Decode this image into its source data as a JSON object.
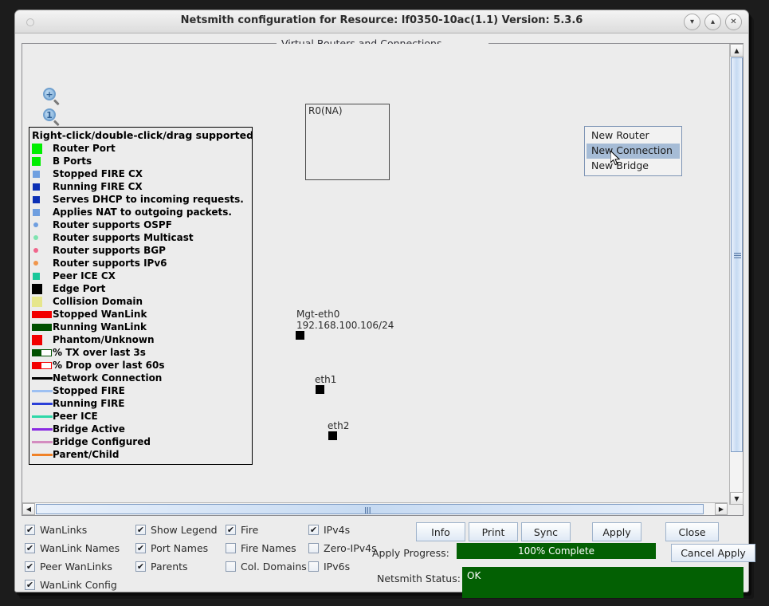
{
  "window": {
    "title": "Netsmith configuration for Resource:  lf0350-10ac(1.1)  Version: 5.3.6",
    "minimize_icon": "chevron-down-icon",
    "maximize_icon": "chevron-up-icon",
    "close_icon": "close-icon"
  },
  "group": {
    "title": "Virtual Routers and Connections"
  },
  "tools": [
    {
      "name": "zoom-in",
      "glyph": "+"
    },
    {
      "name": "zoom-reset",
      "glyph": "1"
    },
    {
      "name": "zoom-out",
      "glyph": "−"
    }
  ],
  "legend": {
    "header": "Right-click/double-click/drag supported",
    "items": [
      {
        "label": "Router Port",
        "swatch": "square-large",
        "color": "#00ee00"
      },
      {
        "label": "B Ports",
        "swatch": "square-medium",
        "color": "#00ee00"
      },
      {
        "label": "Stopped FIRE CX",
        "swatch": "square-small",
        "color": "#6f9fe0"
      },
      {
        "label": "Running FIRE CX",
        "swatch": "square-small",
        "color": "#0b2fb5"
      },
      {
        "label": "Serves DHCP to incoming requests.",
        "swatch": "square-small",
        "color": "#0b2fb5"
      },
      {
        "label": "Applies NAT to outgoing packets.",
        "swatch": "square-small",
        "color": "#6f9fe0"
      },
      {
        "label": "Router supports OSPF",
        "swatch": "dot",
        "color": "#6f9fe0"
      },
      {
        "label": "Router supports Multicast",
        "swatch": "dot",
        "color": "#7fe3b0"
      },
      {
        "label": "Router supports BGP",
        "swatch": "dot",
        "color": "#f0668c"
      },
      {
        "label": "Router supports IPv6",
        "swatch": "dot",
        "color": "#f0964c"
      },
      {
        "label": "Peer ICE CX",
        "swatch": "square-small",
        "color": "#18c79a"
      },
      {
        "label": "Edge Port",
        "swatch": "square-large",
        "color": "#000000"
      },
      {
        "label": "Collision Domain",
        "swatch": "square-large",
        "color": "#e6e68c"
      },
      {
        "label": "Stopped WanLink",
        "swatch": "bar",
        "color": "#f20000"
      },
      {
        "label": "Running WanLink",
        "swatch": "bar",
        "color": "#005000"
      },
      {
        "label": "Phantom/Unknown",
        "swatch": "square-large",
        "color": "#f20000"
      },
      {
        "label": "% TX over last 3s",
        "swatch": "bar-half",
        "color": "#005000"
      },
      {
        "label": "% Drop over last 60s",
        "swatch": "bar-half",
        "color": "#f20000"
      },
      {
        "label": "Network Connection",
        "swatch": "line",
        "color": "#000000"
      },
      {
        "label": "Stopped FIRE",
        "swatch": "line",
        "color": "#9dc0f2"
      },
      {
        "label": "Running FIRE",
        "swatch": "line",
        "color": "#2b3fd8"
      },
      {
        "label": "Peer ICE",
        "swatch": "line",
        "color": "#2fd8a8"
      },
      {
        "label": "Bridge Active",
        "swatch": "line",
        "color": "#8a2be2"
      },
      {
        "label": "Bridge Configured",
        "swatch": "line",
        "color": "#d48cc0"
      },
      {
        "label": "Parent/Child",
        "swatch": "line",
        "color": "#f08228"
      }
    ]
  },
  "canvas": {
    "router": {
      "label": "R0(NA)"
    },
    "ports": [
      {
        "name": "mgt-eth0",
        "line1": "Mgt-eth0",
        "line2": "192.168.100.106/24"
      },
      {
        "name": "eth1",
        "line1": "eth1",
        "line2": ""
      },
      {
        "name": "eth2",
        "line1": "eth2",
        "line2": ""
      }
    ]
  },
  "context_menu": {
    "items": [
      {
        "label": "New Router",
        "selected": false
      },
      {
        "label": "New Connection",
        "selected": true
      },
      {
        "label": "New Bridge",
        "selected": false
      }
    ]
  },
  "checkboxes": [
    {
      "label": "WanLinks",
      "checked": true
    },
    {
      "label": "WanLink Names",
      "checked": true
    },
    {
      "label": "Peer WanLinks",
      "checked": true
    },
    {
      "label": "WanLink Config",
      "checked": true
    },
    {
      "label": "Show Legend",
      "checked": true
    },
    {
      "label": "Port Names",
      "checked": true
    },
    {
      "label": "Parents",
      "checked": true
    },
    {
      "label": "Fire",
      "checked": true
    },
    {
      "label": "Fire Names",
      "checked": false
    },
    {
      "label": "Col. Domains",
      "checked": false
    },
    {
      "label": "IPv4s",
      "checked": true
    },
    {
      "label": "Zero-IPv4s",
      "checked": false
    },
    {
      "label": "IPv6s",
      "checked": false
    }
  ],
  "buttons": {
    "info": "Info",
    "print": "Print",
    "sync": "Sync",
    "apply": "Apply",
    "close": "Close",
    "cancel_apply": "Cancel Apply"
  },
  "status": {
    "progress_label": "Apply Progress:",
    "progress_value": "100% Complete",
    "progress_percent": 100,
    "netsmith_label": "Netsmith Status:",
    "netsmith_value": "OK",
    "ok_color": "#036003"
  }
}
